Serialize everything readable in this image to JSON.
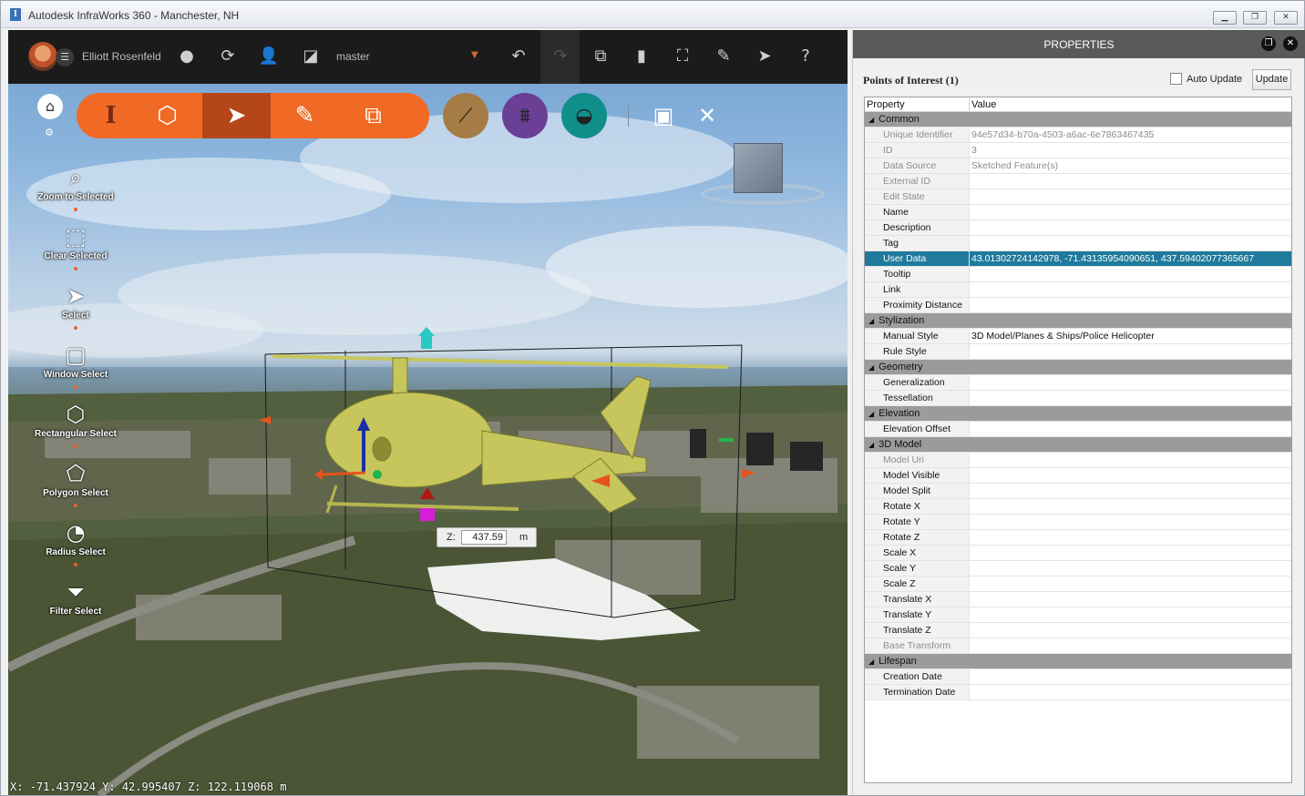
{
  "window": {
    "title": "Autodesk InfraWorks 360 - Manchester, NH",
    "app_icon": "I"
  },
  "topbar": {
    "user_name": "Elliott Rosenfeld",
    "branch": "master",
    "icons": [
      "chat-icon",
      "sync-icon",
      "user-icon",
      "model-icon",
      "undo-icon",
      "redo-icon",
      "layers-icon",
      "book-icon",
      "fullscreen-icon",
      "edit-model-icon",
      "pointer-icon",
      "help-icon"
    ]
  },
  "tools": {
    "zoom_to_selected": "Zoom to Selected",
    "clear_selected": "Clear Selected",
    "select": "Select",
    "window_select": "Window Select",
    "rectangular_select": "Rectangular Select",
    "polygon_select": "Polygon Select",
    "radius_select": "Radius Select",
    "filter_select": "Filter Select"
  },
  "ribbon_colors": {
    "main": "#f06a25",
    "selected": "#b4461a",
    "roads": "#a57c46",
    "bridges": "#6a3f95",
    "drainage": "#0f8e8a"
  },
  "viewport": {
    "z_label": "Z:",
    "z_value": "437.59",
    "z_unit": "m",
    "coords": "X: -71.437924 Y: 42.995407 Z: 122.119068 m"
  },
  "panel": {
    "title": "PROPERTIES",
    "heading": "Points of Interest (1)",
    "auto_update_label": "Auto Update",
    "auto_update_checked": false,
    "update_button": "Update",
    "col_property": "Property",
    "col_value": "Value",
    "sections": [
      {
        "name": "Common",
        "rows": [
          {
            "k": "Unique Identifier",
            "v": "94e57d34-b70a-4503-a6ac-6e7863467435",
            "dim": true
          },
          {
            "k": "ID",
            "v": "3",
            "dim": true
          },
          {
            "k": "Data Source",
            "v": "Sketched Feature(s)",
            "dim": true
          },
          {
            "k": "External ID",
            "v": "",
            "dim": true
          },
          {
            "k": "Edit State",
            "v": "",
            "dim": true
          },
          {
            "k": "Name",
            "v": ""
          },
          {
            "k": "Description",
            "v": ""
          },
          {
            "k": "Tag",
            "v": ""
          },
          {
            "k": "User Data",
            "v": "43.01302724142978, -71.43135954090651, 437.59402077365667",
            "hl": true
          },
          {
            "k": "Tooltip",
            "v": ""
          },
          {
            "k": "Link",
            "v": ""
          },
          {
            "k": "Proximity Distance",
            "v": ""
          }
        ]
      },
      {
        "name": "Stylization",
        "rows": [
          {
            "k": "Manual Style",
            "v": "3D Model/Planes & Ships/Police Helicopter"
          },
          {
            "k": "Rule Style",
            "v": ""
          }
        ]
      },
      {
        "name": "Geometry",
        "rows": [
          {
            "k": "Generalization",
            "v": ""
          },
          {
            "k": "Tessellation",
            "v": ""
          }
        ]
      },
      {
        "name": "Elevation",
        "rows": [
          {
            "k": "Elevation Offset",
            "v": ""
          }
        ]
      },
      {
        "name": "3D Model",
        "rows": [
          {
            "k": "Model Uri",
            "v": "",
            "dim": true
          },
          {
            "k": "Model Visible",
            "v": ""
          },
          {
            "k": "Model Split",
            "v": ""
          },
          {
            "k": "Rotate X",
            "v": ""
          },
          {
            "k": "Rotate Y",
            "v": ""
          },
          {
            "k": "Rotate Z",
            "v": ""
          },
          {
            "k": "Scale X",
            "v": ""
          },
          {
            "k": "Scale Y",
            "v": ""
          },
          {
            "k": "Scale Z",
            "v": ""
          },
          {
            "k": "Translate X",
            "v": ""
          },
          {
            "k": "Translate Y",
            "v": ""
          },
          {
            "k": "Translate Z",
            "v": ""
          },
          {
            "k": "Base Transform",
            "v": "",
            "dim": true
          }
        ]
      },
      {
        "name": "Lifespan",
        "rows": [
          {
            "k": "Creation Date",
            "v": ""
          },
          {
            "k": "Termination Date",
            "v": ""
          }
        ]
      }
    ]
  }
}
